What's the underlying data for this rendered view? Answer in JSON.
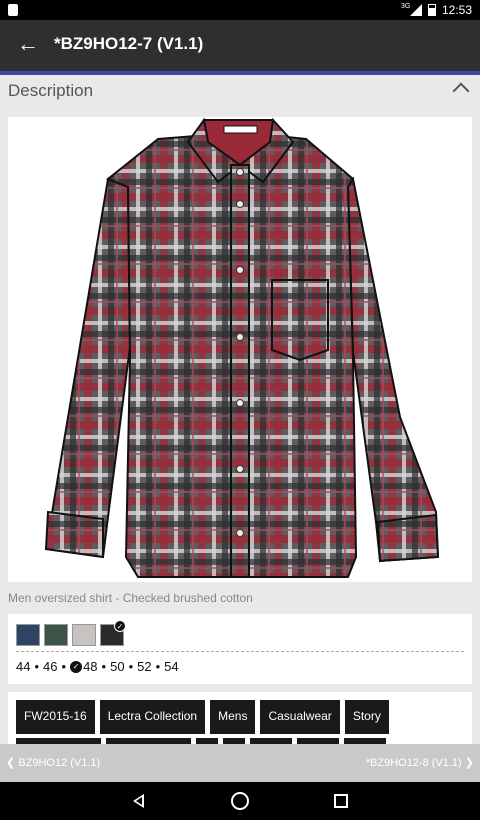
{
  "status_bar": {
    "time": "12:53",
    "network": "3G"
  },
  "app_bar": {
    "title": "*BZ9HO12-7 (V1.1)"
  },
  "section": {
    "title": "Description"
  },
  "product": {
    "caption": "Men oversized shirt - Checked brushed cotton"
  },
  "colors": {
    "swatches": [
      "#2f4466",
      "#3c5448",
      "#c8c3c1",
      "#2a2a2a"
    ],
    "selected_index": 3
  },
  "sizes": {
    "items": [
      "44",
      "46",
      "48",
      "50",
      "52",
      "54"
    ],
    "selected": "48"
  },
  "tags": [
    "FW2015-16",
    "Lectra Collection",
    "Mens",
    "Casualwear",
    "Story"
  ],
  "pager": {
    "prev": "❮ BZ9HO12 (V1.1)",
    "next": "*BZ9HO12-8 (V1.1) ❯"
  },
  "shirt_colors": {
    "base": "#5d5d60",
    "red": "#9a2a3a",
    "light": "#d8d6d6",
    "dark": "#2e2e30"
  }
}
